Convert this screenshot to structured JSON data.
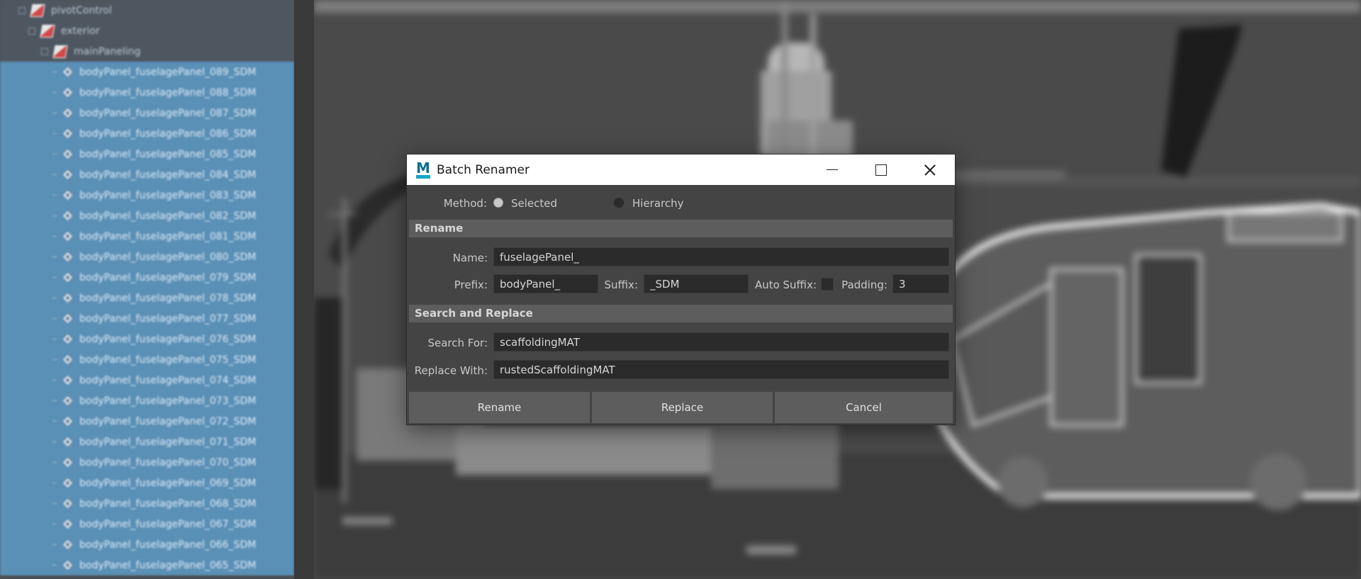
{
  "outliner": {
    "parents": [
      "pivotControl",
      "exterior",
      "mainPaneling"
    ],
    "items": [
      "bodyPanel_fuselagePanel_089_SDM",
      "bodyPanel_fuselagePanel_088_SDM",
      "bodyPanel_fuselagePanel_087_SDM",
      "bodyPanel_fuselagePanel_086_SDM",
      "bodyPanel_fuselagePanel_085_SDM",
      "bodyPanel_fuselagePanel_084_SDM",
      "bodyPanel_fuselagePanel_083_SDM",
      "bodyPanel_fuselagePanel_082_SDM",
      "bodyPanel_fuselagePanel_081_SDM",
      "bodyPanel_fuselagePanel_080_SDM",
      "bodyPanel_fuselagePanel_079_SDM",
      "bodyPanel_fuselagePanel_078_SDM",
      "bodyPanel_fuselagePanel_077_SDM",
      "bodyPanel_fuselagePanel_076_SDM",
      "bodyPanel_fuselagePanel_075_SDM",
      "bodyPanel_fuselagePanel_074_SDM",
      "bodyPanel_fuselagePanel_073_SDM",
      "bodyPanel_fuselagePanel_072_SDM",
      "bodyPanel_fuselagePanel_071_SDM",
      "bodyPanel_fuselagePanel_070_SDM",
      "bodyPanel_fuselagePanel_069_SDM",
      "bodyPanel_fuselagePanel_068_SDM",
      "bodyPanel_fuselagePanel_067_SDM",
      "bodyPanel_fuselagePanel_066_SDM",
      "bodyPanel_fuselagePanel_065_SDM"
    ],
    "colors": {
      "selected": "#5a8fb6",
      "parent": "#4e5760"
    }
  },
  "dialog": {
    "title": "Batch Renamer",
    "app_icon_letter": "M",
    "method": {
      "label": "Method:",
      "options": [
        "Selected",
        "Hierarchy"
      ],
      "selected": "Selected"
    },
    "rename_section": {
      "header": "Rename",
      "name_label": "Name:",
      "name_value": "fuselagePanel_",
      "prefix_label": "Prefix:",
      "prefix_value": "bodyPanel_",
      "suffix_label": "Suffix:",
      "suffix_value": "_SDM",
      "auto_suffix_label": "Auto Suffix:",
      "auto_suffix_checked": false,
      "padding_label": "Padding:",
      "padding_value": "3"
    },
    "search_section": {
      "header": "Search and Replace",
      "search_label": "Search For:",
      "search_value": "scaffoldingMAT",
      "replace_label": "Replace With:",
      "replace_value": "rustedScaffoldingMAT"
    },
    "buttons": {
      "rename": "Rename",
      "replace": "Replace",
      "cancel": "Cancel"
    },
    "icons": {
      "minimize": "minimize-icon",
      "maximize": "maximize-icon",
      "close": "close-icon"
    }
  }
}
